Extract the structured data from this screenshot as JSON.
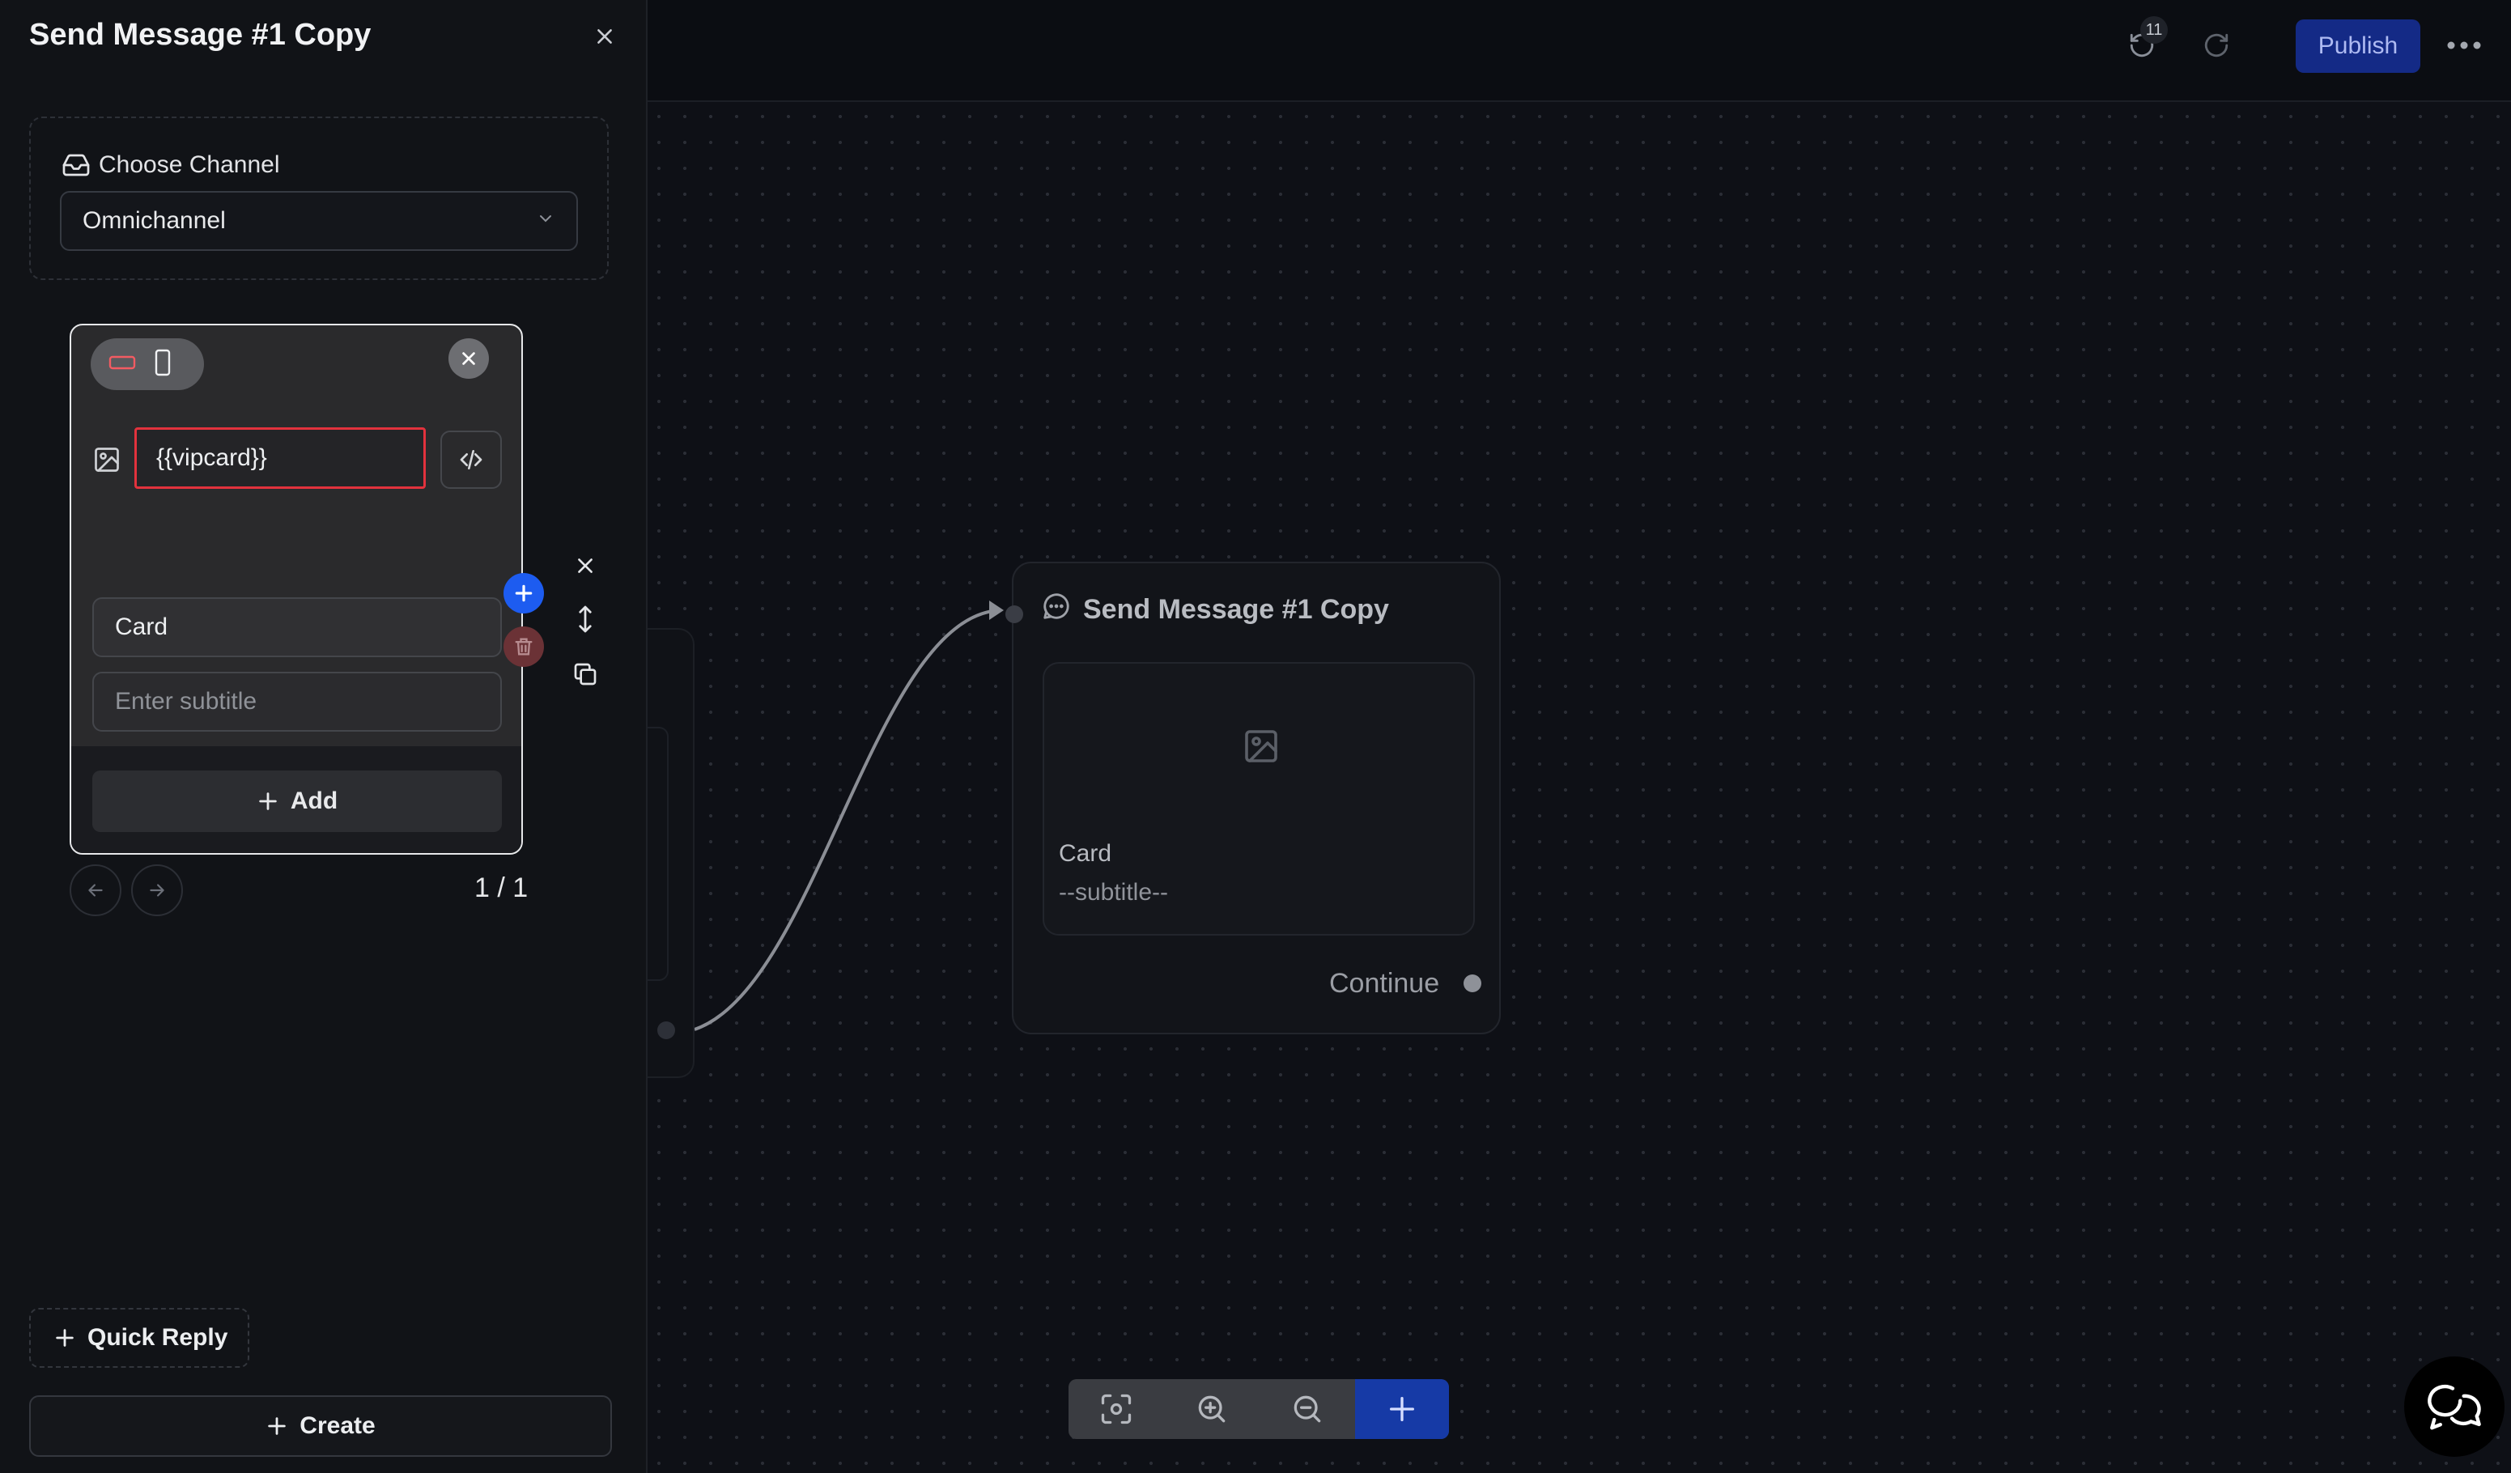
{
  "panel": {
    "title": "Send Message #1 Copy",
    "channel_label": "Choose Channel",
    "channel_value": "Omnichannel",
    "card_editor": {
      "image_url_value": "{{vipcard}}",
      "title_value": "Card",
      "subtitle_placeholder": "Enter subtitle",
      "add_label": "Add"
    },
    "pager": "1 / 1",
    "quick_reply_label": "Quick Reply",
    "create_label": "Create"
  },
  "topbar": {
    "undo_count": "11",
    "publish_label": "Publish"
  },
  "canvas": {
    "node": {
      "title": "Send Message #1 Copy",
      "card_title": "Card",
      "card_subtitle": "--subtitle--",
      "continue_label": "Continue"
    }
  },
  "colors": {
    "accent_blue": "#1d5cf0",
    "publish_bg": "#142a86",
    "error_red": "#e2323d"
  },
  "icons": [
    "close-icon",
    "inbox-icon",
    "chevron-down-icon",
    "desktop-icon",
    "mobile-icon",
    "image-icon",
    "code-icon",
    "plus-icon",
    "trash-icon",
    "move-icon",
    "copy-icon",
    "arrow-left-icon",
    "arrow-right-icon",
    "undo-icon",
    "redo-icon",
    "more-icon",
    "chat-bubble-icon",
    "focus-icon",
    "zoom-in-icon",
    "zoom-out-icon",
    "chat-icon"
  ]
}
